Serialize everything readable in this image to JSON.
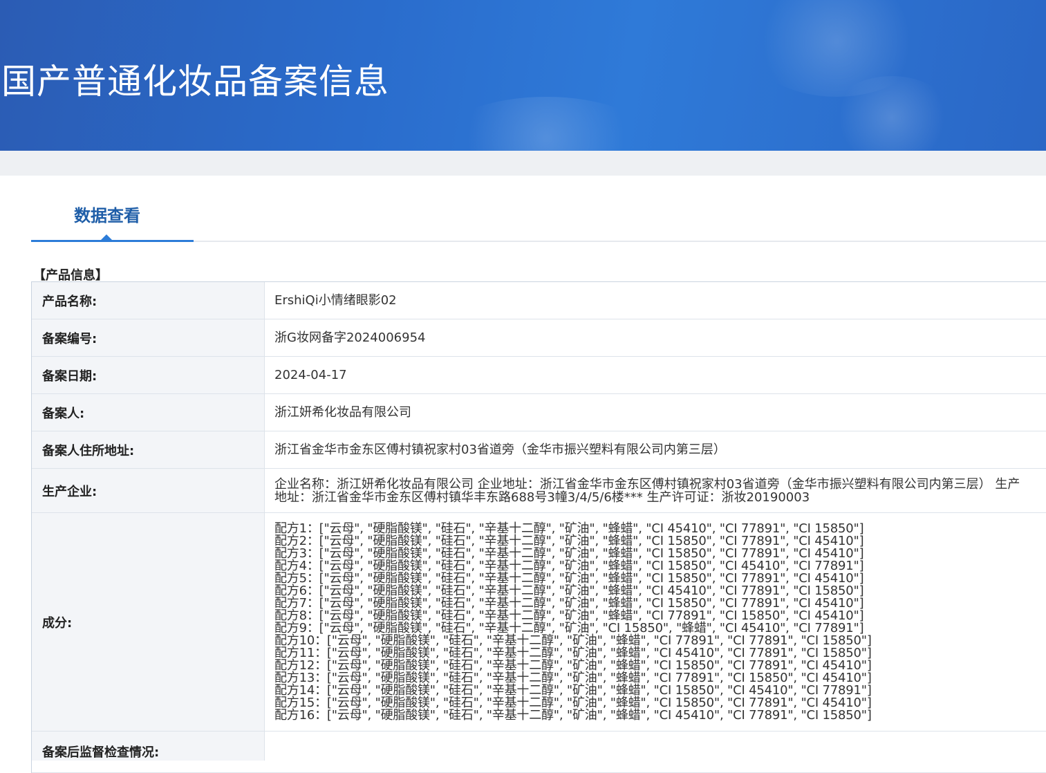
{
  "banner": {
    "title": "国产普通化妆品备案信息"
  },
  "tabs": {
    "active_label": "数据查看"
  },
  "section": {
    "title": "【产品信息】"
  },
  "rows": [
    {
      "label": "产品名称:",
      "value": "ErshiQi小情绪眼影02"
    },
    {
      "label": "备案编号:",
      "value": "浙G妆网备字2024006954"
    },
    {
      "label": "备案日期:",
      "value": "2024-04-17"
    },
    {
      "label": "备案人:",
      "value": "浙江妍希化妆品有限公司"
    },
    {
      "label": "备案人住所地址:",
      "value": "浙江省金华市金东区傅村镇祝家村03省道旁（金华市振兴塑料有限公司内第三层）"
    },
    {
      "label": "生产企业:",
      "value": "企业名称：浙江妍希化妆品有限公司 企业地址：浙江省金华市金东区傅村镇祝家村03省道旁（金华市振兴塑料有限公司内第三层） 生产地址：浙江省金华市金东区傅村镇华丰东路688号3幢3/4/5/6楼*** 生产许可证：浙妆20190003"
    }
  ],
  "ingredients": {
    "label": "成分:",
    "lines": [
      "配方1：[\"云母\", \"硬脂酸镁\", \"硅石\", \"辛基十二醇\", \"矿油\", \"蜂蜡\", \"CI 45410\", \"CI 77891\", \"CI 15850\"]",
      "配方2：[\"云母\", \"硬脂酸镁\", \"硅石\", \"辛基十二醇\", \"矿油\", \"蜂蜡\", \"CI 15850\", \"CI 77891\", \"CI 45410\"]",
      "配方3：[\"云母\", \"硬脂酸镁\", \"硅石\", \"辛基十二醇\", \"矿油\", \"蜂蜡\", \"CI 15850\", \"CI 77891\", \"CI 45410\"]",
      "配方4：[\"云母\", \"硬脂酸镁\", \"硅石\", \"辛基十二醇\", \"矿油\", \"蜂蜡\", \"CI 15850\", \"CI 45410\", \"CI 77891\"]",
      "配方5：[\"云母\", \"硬脂酸镁\", \"硅石\", \"辛基十二醇\", \"矿油\", \"蜂蜡\", \"CI 15850\", \"CI 77891\", \"CI 45410\"]",
      "配方6：[\"云母\", \"硬脂酸镁\", \"硅石\", \"辛基十二醇\", \"矿油\", \"蜂蜡\", \"CI 45410\", \"CI 77891\", \"CI 15850\"]",
      "配方7：[\"云母\", \"硬脂酸镁\", \"硅石\", \"辛基十二醇\", \"矿油\", \"蜂蜡\", \"CI 15850\", \"CI 77891\", \"CI 45410\"]",
      "配方8：[\"云母\", \"硬脂酸镁\", \"硅石\", \"辛基十二醇\", \"矿油\", \"蜂蜡\", \"CI 77891\", \"CI 15850\", \"CI 45410\"]",
      "配方9：[\"云母\", \"硬脂酸镁\", \"硅石\", \"辛基十二醇\", \"矿油\", \"CI 15850\", \"蜂蜡\", \"CI 45410\", \"CI 77891\"]",
      "配方10：[\"云母\", \"硬脂酸镁\", \"硅石\", \"辛基十二醇\", \"矿油\", \"蜂蜡\", \"CI 77891\", \"CI 77891\", \"CI 15850\"]",
      "配方11：[\"云母\", \"硬脂酸镁\", \"硅石\", \"辛基十二醇\", \"矿油\", \"蜂蜡\", \"CI 45410\", \"CI 77891\", \"CI 15850\"]",
      "配方12：[\"云母\", \"硬脂酸镁\", \"硅石\", \"辛基十二醇\", \"矿油\", \"蜂蜡\", \"CI 15850\", \"CI 77891\", \"CI 45410\"]",
      "配方13：[\"云母\", \"硬脂酸镁\", \"硅石\", \"辛基十二醇\", \"矿油\", \"蜂蜡\", \"CI 77891\", \"CI 15850\", \"CI 45410\"]",
      "配方14：[\"云母\", \"硬脂酸镁\", \"硅石\", \"辛基十二醇\", \"矿油\", \"蜂蜡\", \"CI 15850\", \"CI 45410\", \"CI 77891\"]",
      "配方15：[\"云母\", \"硬脂酸镁\", \"硅石\", \"辛基十二醇\", \"矿油\", \"蜂蜡\", \"CI 15850\", \"CI 77891\", \"CI 45410\"]",
      "配方16：[\"云母\", \"硬脂酸镁\", \"硅石\", \"辛基十二醇\", \"矿油\", \"蜂蜡\", \"CI 45410\", \"CI 77891\", \"CI 15850\"]"
    ]
  },
  "last_row": {
    "label": "备案后监督检查情况:"
  },
  "colors": {
    "banner_blue": "#2a6ccc",
    "tab_accent": "#2c7cd8",
    "tab_text": "#1f5ea8",
    "label_bg": "#f3f5f8"
  }
}
